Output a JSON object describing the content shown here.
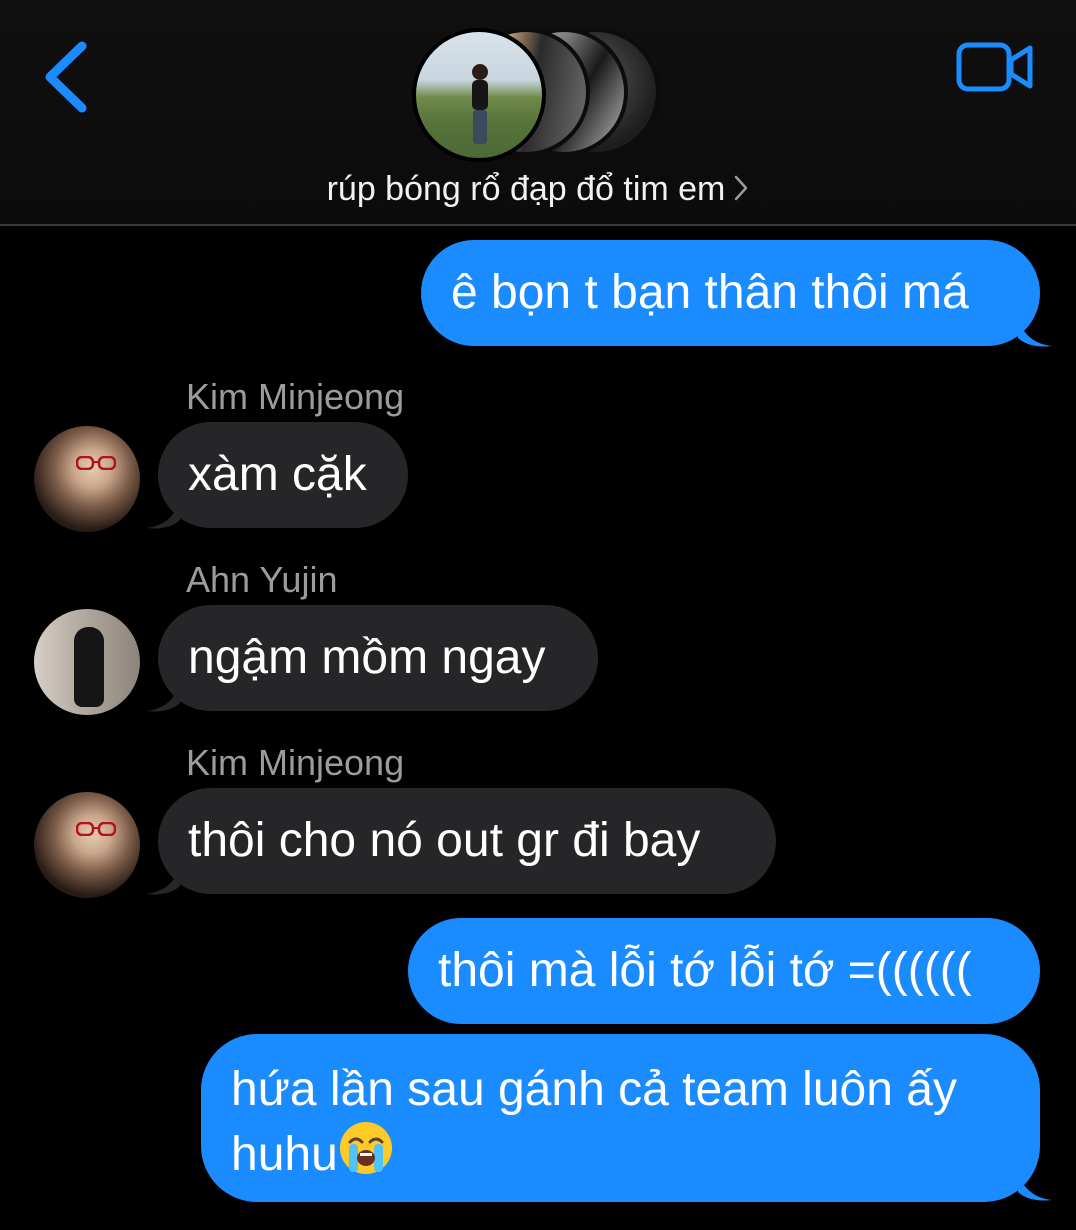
{
  "header": {
    "group_name": "rúp bóng rổ đạp đổ tim em",
    "back_icon": "chevron-left-icon",
    "video_icon": "video-camera-icon",
    "accent_color": "#1b8cff"
  },
  "messages": [
    {
      "direction": "outgoing",
      "text": "ê bọn t bạn thân thôi má"
    },
    {
      "direction": "incoming",
      "sender": "Kim Minjeong",
      "text": "xàm cặk"
    },
    {
      "direction": "incoming",
      "sender": "Ahn Yujin",
      "text": "ngậm mồm ngay"
    },
    {
      "direction": "incoming",
      "sender": "Kim Minjeong",
      "text": "thôi cho nó out gr đi bay"
    },
    {
      "direction": "outgoing",
      "text": "thôi mà lỗi tớ lỗi tớ =(((((("
    },
    {
      "direction": "outgoing",
      "line1": "hứa lần sau gánh cả team luôn ấy",
      "line2": "huhu",
      "emoji": "loudly-crying-face-icon"
    }
  ],
  "colors": {
    "outgoing_bubble": "#1b8cff",
    "incoming_bubble": "#262629",
    "background": "#000000",
    "sender_name": "#9c9c9f"
  }
}
